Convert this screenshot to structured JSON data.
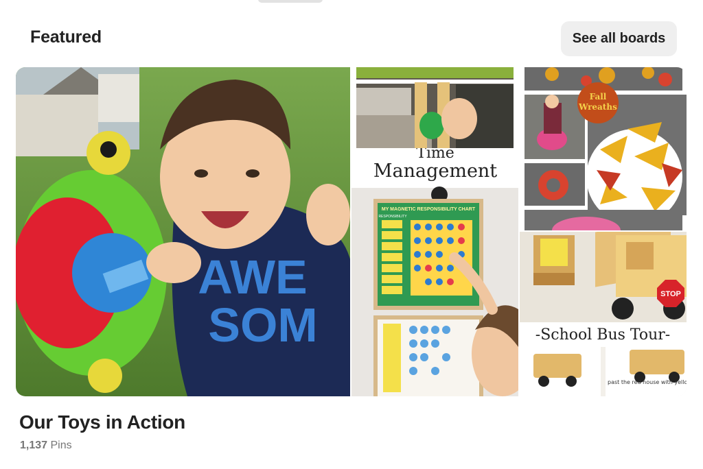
{
  "section": {
    "title": "Featured",
    "see_all_label": "See all boards"
  },
  "board": {
    "name": "Our Toys in Action",
    "pin_count": "1,137",
    "pin_label": "Pins",
    "images": {
      "main": {
        "shirt_text_1": "AWE",
        "shirt_text_2": "SOM"
      },
      "time_mgmt": {
        "title_line1": "Time",
        "title_line2": "Management",
        "chart_title": "MY MAGNETIC RESPONSIBILITY CHART",
        "subtitle": "RESPONSIBILITY"
      },
      "fall": {
        "badge_line1": "Fall",
        "badge_line2": "Wreaths"
      },
      "bus": {
        "title": "-School Bus Tour-",
        "stop_text": "STOP",
        "note": "past the red house with yellow flowers"
      }
    }
  }
}
